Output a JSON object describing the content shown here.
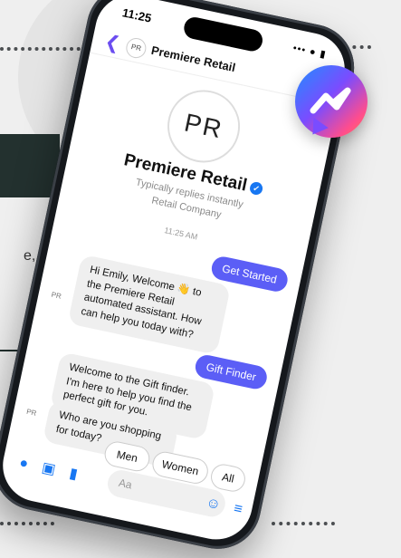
{
  "background_fragments": {
    "text_fragment": "e,"
  },
  "status_bar": {
    "time": "11:25",
    "icons": "••• ● ▮"
  },
  "header": {
    "back_icon": "chevron-left-icon",
    "avatar_initials": "PR",
    "title": "Premiere Retail"
  },
  "profile": {
    "avatar_initials": "PR",
    "name": "Premiere Retail",
    "verified_icon": "verified-badge-icon",
    "reply_status": "Typically replies instantly",
    "category": "Retail Company"
  },
  "conversation": {
    "timestamp": "11:25 AM",
    "messages": [
      {
        "from": "user",
        "text": "Get Started"
      },
      {
        "from": "bot",
        "sender_tag": "PR",
        "text": "Hi Emily, Welcome 👋 to the Premiere Retail automated assistant. How can help you today with?"
      },
      {
        "from": "user",
        "text": "Gift Finder"
      },
      {
        "from": "bot",
        "text": "Welcome to the Gift finder. I'm here to help you find the perfect gift for you."
      },
      {
        "from": "bot",
        "sender_tag": "PR",
        "text": "Who are you shopping for today?"
      }
    ]
  },
  "quick_replies": [
    "Men",
    "Women",
    "All"
  ],
  "composer": {
    "placeholder": "Aa",
    "icons": [
      "camera-icon",
      "image-icon",
      "microphone-icon",
      "emoji-icon",
      "menu-icon"
    ]
  },
  "brand": {
    "logo_icon": "messenger-logo-icon",
    "accent": "#5b5ef6",
    "link": "#1877f2"
  }
}
